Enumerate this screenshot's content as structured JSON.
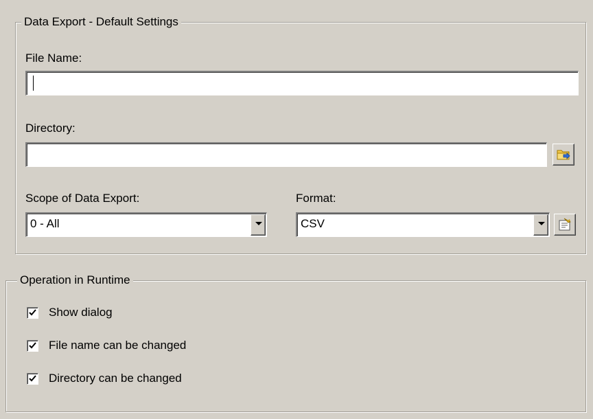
{
  "export_group": {
    "title": "Data Export - Default Settings",
    "file_name_label": "File Name:",
    "file_name_value": "",
    "directory_label": "Directory:",
    "directory_value": "",
    "scope_label": "Scope of Data Export:",
    "scope_value": "0 - All",
    "format_label": "Format:",
    "format_value": "CSV"
  },
  "runtime_group": {
    "title": "Operation in Runtime",
    "checkboxes": [
      {
        "label": "Show dialog",
        "checked": true
      },
      {
        "label": "File name can be changed",
        "checked": true
      },
      {
        "label": "Directory can be changed",
        "checked": true
      }
    ]
  },
  "icons": {
    "browse": "folder-browse-icon",
    "format_settings": "format-settings-icon"
  }
}
